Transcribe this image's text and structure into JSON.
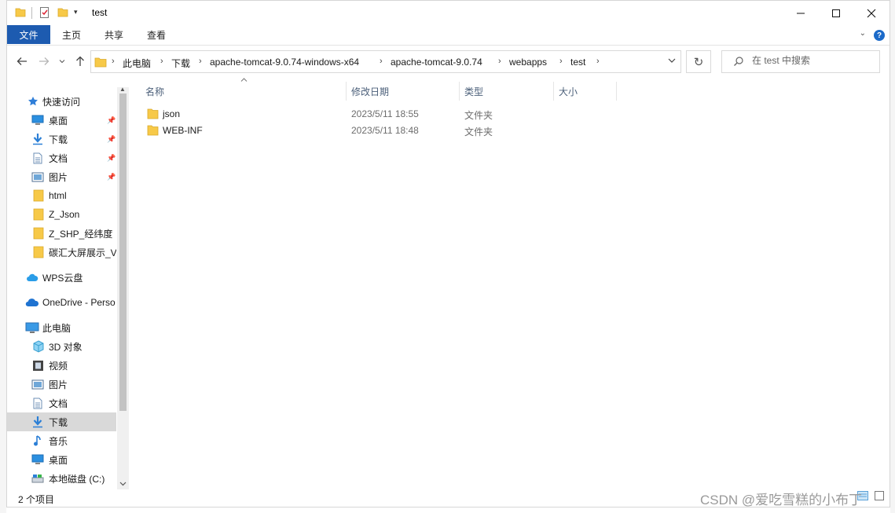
{
  "window": {
    "title": "test",
    "controls": {
      "minimize": "—",
      "maximize": "☐",
      "close": "✕"
    }
  },
  "ribbon": {
    "tabs": [
      "文件",
      "主页",
      "共享",
      "查看"
    ],
    "help": "?"
  },
  "address": {
    "crumbs": [
      "此电脑",
      "下载",
      "apache-tomcat-9.0.74-windows-x64",
      "apache-tomcat-9.0.74",
      "webapps",
      "test"
    ]
  },
  "search": {
    "placeholder": "在 test 中搜索"
  },
  "sidebar": {
    "items": [
      {
        "label": "快速访问",
        "icon": "star-icon"
      },
      {
        "label": "桌面",
        "icon": "desktop-icon",
        "pinned": true
      },
      {
        "label": "下载",
        "icon": "download-icon",
        "pinned": true
      },
      {
        "label": "文档",
        "icon": "document-icon",
        "pinned": true
      },
      {
        "label": "图片",
        "icon": "picture-icon",
        "pinned": true
      },
      {
        "label": "html",
        "icon": "folder-icon"
      },
      {
        "label": "Z_Json",
        "icon": "folder-icon"
      },
      {
        "label": "Z_SHP_经纬度",
        "icon": "folder-icon"
      },
      {
        "label": "碳汇大屏展示_V",
        "icon": "folder-icon"
      },
      {
        "label": "WPS云盘",
        "icon": "cloud-icon"
      },
      {
        "label": "OneDrive - Perso",
        "icon": "onedrive-icon"
      },
      {
        "label": "此电脑",
        "icon": "computer-icon"
      },
      {
        "label": "3D 对象",
        "icon": "cube-icon"
      },
      {
        "label": "视频",
        "icon": "video-icon"
      },
      {
        "label": "图片",
        "icon": "picture-icon"
      },
      {
        "label": "文档",
        "icon": "document-icon"
      },
      {
        "label": "下载",
        "icon": "download-icon",
        "selected": true
      },
      {
        "label": "音乐",
        "icon": "music-icon"
      },
      {
        "label": "桌面",
        "icon": "desktop-icon"
      },
      {
        "label": "本地磁盘 (C:)",
        "icon": "drive-icon"
      }
    ]
  },
  "columns": [
    "名称",
    "修改日期",
    "类型",
    "大小"
  ],
  "files": [
    {
      "name": "json",
      "modified": "2023/5/11 18:55",
      "type": "文件夹",
      "size": ""
    },
    {
      "name": "WEB-INF",
      "modified": "2023/5/11 18:48",
      "type": "文件夹",
      "size": ""
    }
  ],
  "status": {
    "count": "2 个项目"
  },
  "watermark": "CSDN @爱吃雪糕的小布丁",
  "colors": {
    "accent": "#1d5bb0",
    "folder": "#f7c948",
    "selected": "#d9d9d9"
  }
}
